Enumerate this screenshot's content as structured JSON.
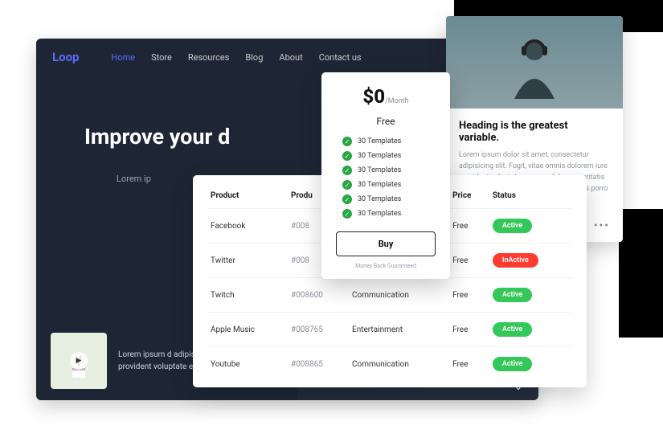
{
  "brand": "Loop",
  "nav": {
    "items": [
      "Home",
      "Store",
      "Resources",
      "Blog",
      "About",
      "Contact us"
    ],
    "activeIndex": 0
  },
  "hero": {
    "title": "Improve your d",
    "subtitle": "Lorem ip",
    "footerText": "Lorem ipsum d adipisicing elit. iure provident voluptate esse"
  },
  "article": {
    "heading": "Heading is the greatest variable.",
    "body": "Lorem ipsum dolor sit amet, consectetur adipisicing elit. Fugit, vitae omnis dolorem iure provident voluptate esse ea, dolorum veritatis totam voluptas nostrum voluptates quos porro a pariatur accusamus ipsum!"
  },
  "pricing": {
    "amount": "$0",
    "unit": "/Month",
    "plan": "Free",
    "features": [
      "30 Templates",
      "30 Templates",
      "30 Templates",
      "30 Templates",
      "30 Templates",
      "30 Templates"
    ],
    "buy": "Buy",
    "guarantee": "Money Back Guaranteed"
  },
  "table": {
    "headers": [
      "Product",
      "Produ",
      "",
      "Price",
      "Status"
    ],
    "rows": [
      {
        "product": "Facebook",
        "id": "#008",
        "category": "",
        "price": "Free",
        "status": "Active",
        "statusClass": "active"
      },
      {
        "product": "Twitter",
        "id": "#008",
        "category": "",
        "price": "Free",
        "status": "InActive",
        "statusClass": "inactive"
      },
      {
        "product": "Twitch",
        "id": "#008600",
        "category": "Communication",
        "price": "Free",
        "status": "Active",
        "statusClass": "active"
      },
      {
        "product": "Apple Music",
        "id": "#008765",
        "category": "Entertainment",
        "price": "Free",
        "status": "Active",
        "statusClass": "active"
      },
      {
        "product": "Youtube",
        "id": "#008865",
        "category": "Communication",
        "price": "Free",
        "status": "Active",
        "statusClass": "active"
      }
    ]
  }
}
